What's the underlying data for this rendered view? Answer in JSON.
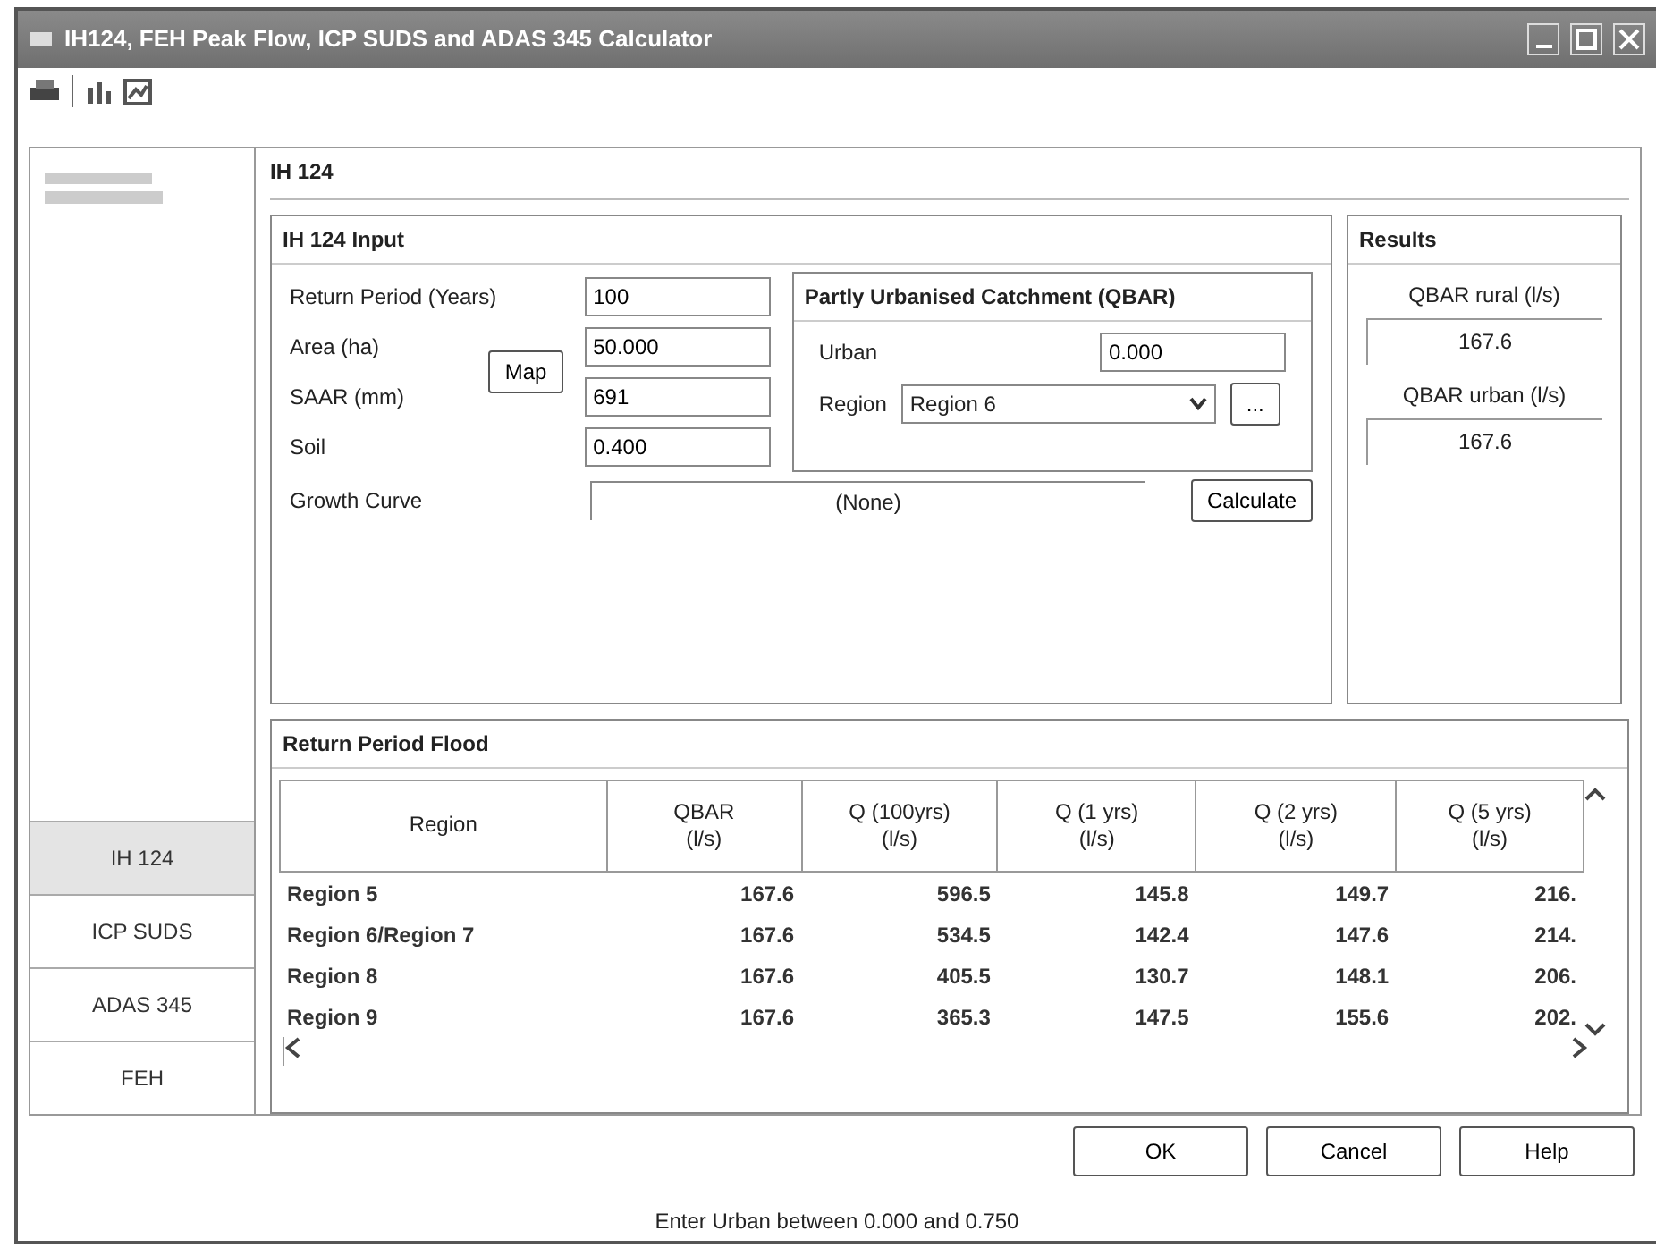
{
  "window": {
    "title": "IH124, FEH Peak Flow, ICP SUDS and ADAS 345 Calculator"
  },
  "page_title": "IH 124",
  "side_tabs": [
    {
      "label": "IH 124",
      "selected": true
    },
    {
      "label": "ICP SUDS",
      "selected": false
    },
    {
      "label": "ADAS 345",
      "selected": false
    },
    {
      "label": "FEH",
      "selected": false
    }
  ],
  "input": {
    "title": "IH 124 Input",
    "fields": [
      {
        "label": "Return Period (Years)",
        "value": "100"
      },
      {
        "label": "Area (ha)",
        "value": "50.000"
      },
      {
        "label": "SAAR (mm)",
        "value": "691"
      },
      {
        "label": "Soil",
        "value": "0.400"
      }
    ],
    "map_button": "Map",
    "growth_curve": {
      "label": "Growth Curve",
      "value": "(None)"
    },
    "urban_group": {
      "title": "Partly Urbanised Catchment (QBAR)",
      "urban_label": "Urban",
      "urban_value": "0.000",
      "region_label": "Region",
      "region_value": "Region 6",
      "browse_button": "..."
    },
    "calculate_button": "Calculate"
  },
  "results": {
    "title": "Results",
    "items": [
      {
        "label": "QBAR rural (l/s)",
        "value": "167.6"
      },
      {
        "label": "QBAR urban (l/s)",
        "value": "167.6"
      }
    ]
  },
  "table": {
    "title": "Return Period Flood",
    "columns": [
      {
        "label": "Region"
      },
      {
        "label": "QBAR",
        "unit": "(l/s)"
      },
      {
        "label": "Q (100yrs)",
        "unit": "(l/s)"
      },
      {
        "label": "Q (1 yrs)",
        "unit": "(l/s)"
      },
      {
        "label": "Q (2 yrs)",
        "unit": "(l/s)"
      },
      {
        "label": "Q (5 yrs)",
        "unit": "(l/s)"
      }
    ],
    "rows": [
      [
        "Region 5",
        "167.6",
        "596.5",
        "145.8",
        "149.7",
        "216."
      ],
      [
        "Region 6/Region 7",
        "167.6",
        "534.5",
        "142.4",
        "147.6",
        "214."
      ],
      [
        "Region 8",
        "167.6",
        "405.5",
        "130.7",
        "148.1",
        "206."
      ],
      [
        "Region 9",
        "167.6",
        "365.3",
        "147.5",
        "155.6",
        "202."
      ]
    ]
  },
  "buttons": [
    "OK",
    "Cancel",
    "Help"
  ],
  "status_bar": "Enter Urban between 0.000 and 0.750"
}
